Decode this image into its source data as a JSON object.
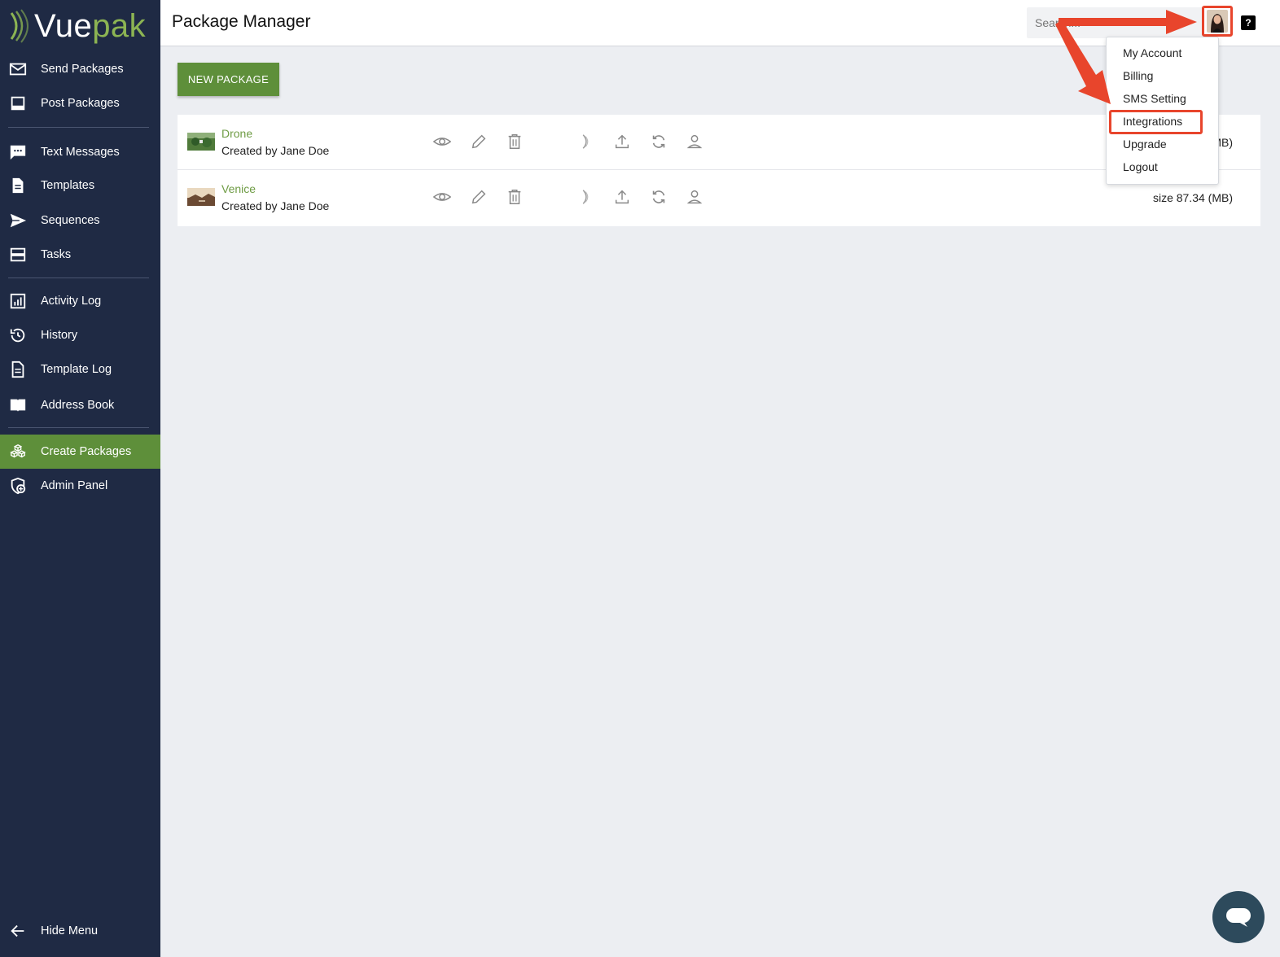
{
  "brand": {
    "name_part1": "Vue",
    "name_part2": "pak",
    "accent": "#8cb453"
  },
  "sidebar": {
    "items": [
      {
        "label": "Send Packages",
        "icon": "envelope-icon"
      },
      {
        "label": "Post Packages",
        "icon": "monitor-icon"
      },
      {
        "label": "Text Messages",
        "icon": "chat-bubble-icon"
      },
      {
        "label": "Templates",
        "icon": "document-icon"
      },
      {
        "label": "Sequences",
        "icon": "send-icon"
      },
      {
        "label": "Tasks",
        "icon": "stack-icon"
      },
      {
        "label": "Activity Log",
        "icon": "chart-icon"
      },
      {
        "label": "History",
        "icon": "history-icon"
      },
      {
        "label": "Template Log",
        "icon": "document-icon"
      },
      {
        "label": "Address Book",
        "icon": "book-icon"
      },
      {
        "label": "Create Packages",
        "icon": "boxes-icon",
        "active": true
      },
      {
        "label": "Admin Panel",
        "icon": "admin-icon"
      }
    ],
    "hide_menu": "Hide Menu"
  },
  "header": {
    "title": "Package Manager",
    "search_placeholder": "Search...",
    "help_label": "?"
  },
  "main": {
    "new_package_label": "NEW PACKAGE",
    "packages": [
      {
        "name": "Drone",
        "creator": "Created by Jane Doe",
        "size": "MB)"
      },
      {
        "name": "Venice",
        "creator": "Created by Jane Doe",
        "size": "size 87.34 (MB)"
      }
    ]
  },
  "user_menu": {
    "items": [
      "My Account",
      "Billing",
      "SMS Setting",
      "Integrations",
      "Upgrade",
      "Logout"
    ],
    "highlighted": "Integrations"
  },
  "colors": {
    "sidebar_bg": "#1f2a44",
    "active_green": "#5e8f3a",
    "link_green": "#6f9c45",
    "annotation_red": "#e8452c"
  }
}
